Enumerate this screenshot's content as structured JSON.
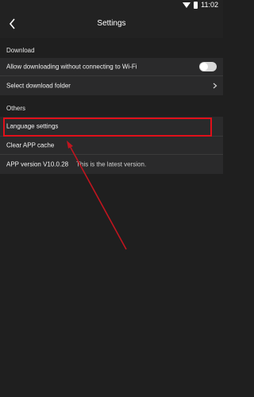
{
  "status_bar": {
    "time": "11:02"
  },
  "app_bar": {
    "title": "Settings",
    "back_icon": "chevron-left-icon"
  },
  "sections": {
    "download": {
      "header": "Download",
      "items": [
        {
          "label": "Allow downloading without connecting to Wi-Fi",
          "control": "toggle",
          "toggle_on": false
        },
        {
          "label": "Select download folder",
          "control": "chevron"
        }
      ]
    },
    "others": {
      "header": "Others",
      "items": [
        {
          "label": "Language settings"
        },
        {
          "label": "Clear APP cache"
        },
        {
          "label": "APP version V10.0.28",
          "note": "This is the latest version."
        }
      ]
    }
  },
  "colors": {
    "background": "#1f1f1f",
    "row_background": "#2a2a2b",
    "highlight": "#e0101a",
    "arrow": "#c0151f"
  }
}
